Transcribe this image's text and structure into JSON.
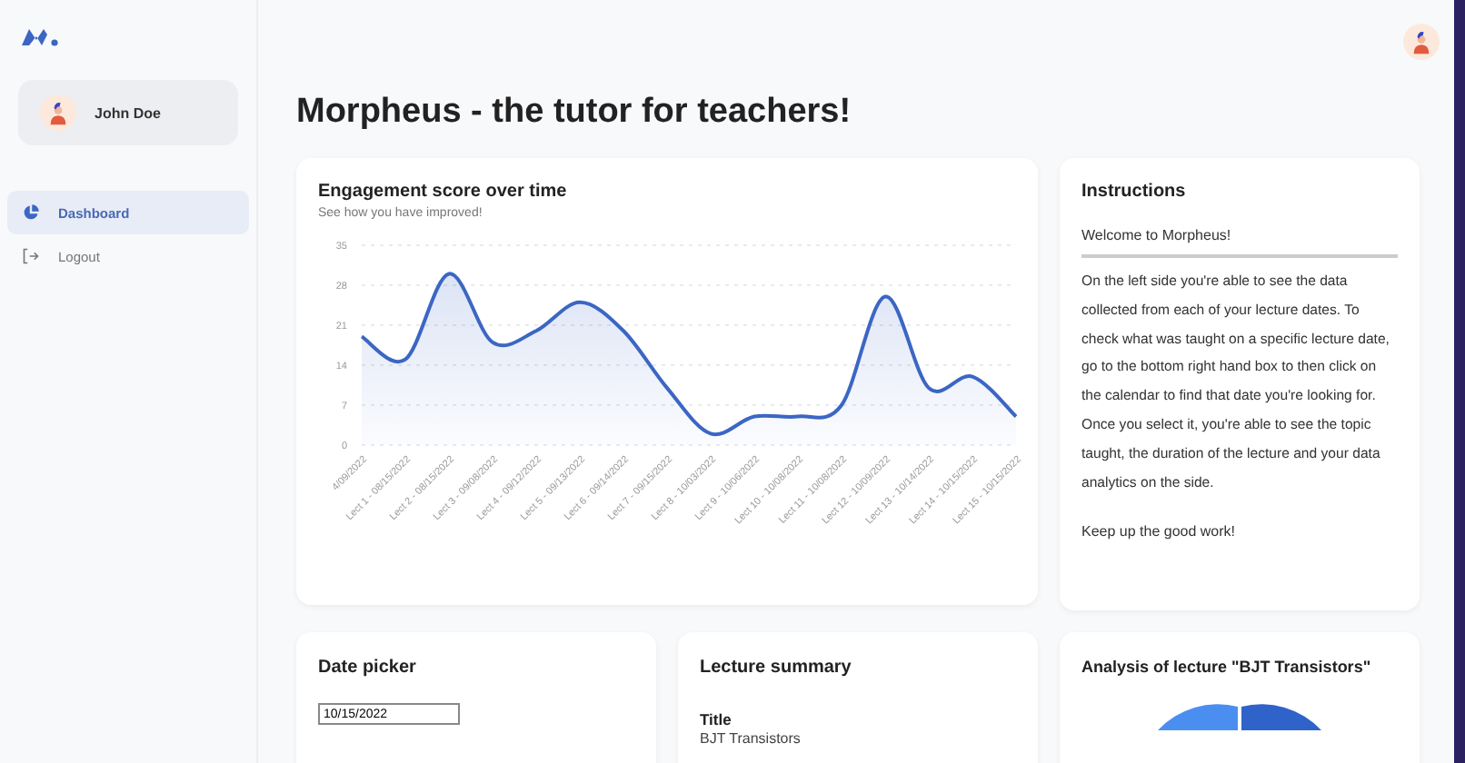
{
  "sidebar": {
    "user": {
      "name": "John Doe"
    },
    "items": [
      {
        "label": "Dashboard",
        "selected": true
      },
      {
        "label": "Logout",
        "selected": false
      }
    ]
  },
  "page_title": "Morpheus - the tutor for teachers!",
  "engagement": {
    "title": "Engagement score over time",
    "subtitle": "See how you have improved!",
    "chart_data": {
      "type": "area",
      "categories": [
        "4/09/2022",
        "Lect 1 - 08/15/2022",
        "Lect 2 - 08/15/2022",
        "Lect 3 - 09/08/2022",
        "Lect 4 - 09/12/2022",
        "Lect 5 - 09/13/2022",
        "Lect 6 - 09/14/2022",
        "Lect 7 - 09/15/2022",
        "Lect 8 - 10/03/2022",
        "Lect 9 - 10/06/2022",
        "Lect 10 - 10/08/2022",
        "Lect 11 - 10/08/2022",
        "Lect 12 - 10/09/2022",
        "Lect 13 - 10/14/2022",
        "Lect 14 - 10/15/2022",
        "Lect 15 - 10/15/2022"
      ],
      "series": [
        {
          "color": "#3b66c4",
          "values": [
            19,
            15,
            30,
            18,
            20,
            25,
            20,
            10,
            2,
            5,
            5,
            7,
            26,
            10,
            12,
            5
          ]
        }
      ],
      "grid": true,
      "ylim": [
        0,
        35
      ],
      "yticks": [
        0,
        7,
        14,
        21,
        28,
        35
      ]
    }
  },
  "instructions": {
    "title": "Instructions",
    "welcome": "Welcome to Morpheus!",
    "body": "On the left side you're able to see the data collected from each of your lecture dates. To check what was taught on a specific lecture date, go to the bottom right hand box to then click on the calendar to find that date you're looking for. Once you select it, you're able to see the topic taught, the duration of the lecture and your data analytics on the side.",
    "footer": "Keep up the good work!"
  },
  "date_picker": {
    "title": "Date picker",
    "value": "10/15/2022"
  },
  "lecture_summary": {
    "title": "Lecture summary",
    "field_label": "Title",
    "field_value": "BJT Transistors"
  },
  "analysis": {
    "title": "Analysis of lecture \"BJT Transistors\""
  }
}
